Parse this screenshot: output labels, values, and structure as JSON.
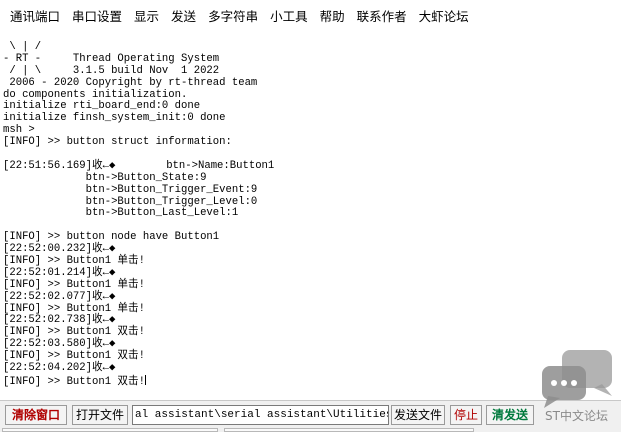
{
  "menu": [
    "通讯端口",
    "串口设置",
    "显示",
    "发送",
    "多字符串",
    "小工具",
    "帮助",
    "联系作者",
    "大虾论坛"
  ],
  "terminal_lines": [
    " \\ | /",
    "- RT -     Thread Operating System",
    " / | \\     3.1.5 build Nov  1 2022",
    " 2006 - 2020 Copyright by rt-thread team",
    "do components initialization.",
    "initialize rti_board_end:0 done",
    "initialize finsh_system_init:0 done",
    "msh >",
    "[INFO] >> button struct information:",
    "",
    "[22:51:56.169]收←◆        btn->Name:Button1",
    "             btn->Button_State:9",
    "             btn->Button_Trigger_Event:9",
    "             btn->Button_Trigger_Level:0",
    "             btn->Button_Last_Level:1",
    "",
    "[INFO] >> button node have Button1",
    "[22:52:00.232]收←◆",
    "[INFO] >> Button1 单击!",
    "[22:52:01.214]收←◆",
    "[INFO] >> Button1 单击!",
    "[22:52:02.077]收←◆",
    "[INFO] >> Button1 单击!",
    "[22:52:02.738]收←◆",
    "[INFO] >> Button1 双击!",
    "[22:52:03.580]收←◆",
    "[INFO] >> Button1 双击!",
    "[22:52:04.202]收←◆",
    "[INFO] >> Button1 双击!"
  ],
  "bottom": {
    "clear_window": "清除窗口",
    "open_file": "打开文件",
    "file_path": "al assistant\\serial assistant\\Utilities.cs",
    "send_file": "发送文件",
    "stop": "停止",
    "clear_send": "清发送"
  },
  "watermark": {
    "text": "ST中文论坛"
  },
  "colors": {
    "clear_window": "#b00000",
    "stop": "#b00000",
    "clear_send": "#007a3d",
    "watermark": "#8a8a8a"
  }
}
